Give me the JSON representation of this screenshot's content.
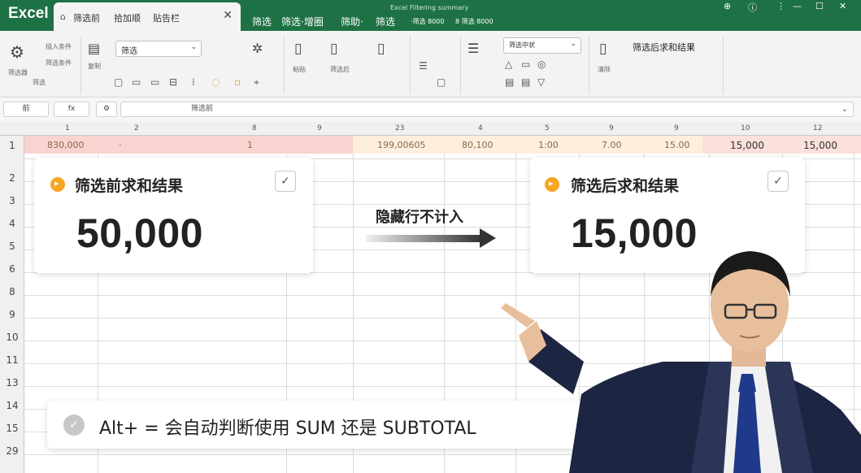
{
  "app": {
    "name": "Excel",
    "doc_title": "Excel Filtering summary"
  },
  "tab": {
    "items": [
      "筛选前",
      "拾加顺",
      "贴告栏"
    ]
  },
  "menu": [
    "筛选",
    "筛选·增圈",
    "筛助·",
    "筛选",
    "·筛选 8000",
    "8 筛选 8000"
  ],
  "ribbon": {
    "heading": "筛选后求和结果",
    "select1": "筛选",
    "select2": "筛选中状",
    "labels": [
      "筛选器",
      "插入条件",
      "筛选条件",
      "筛选",
      "复制",
      "粘贴",
      "筛选后",
      "清除"
    ]
  },
  "formula_bar": {
    "name_box": "前",
    "fx": "fx",
    "content": "筛选前"
  },
  "grid": {
    "columns": [
      "1",
      "2",
      "8",
      "9",
      "23",
      "4",
      "5",
      "9",
      "9",
      "10",
      "12"
    ],
    "rows": [
      "1",
      "2",
      "3",
      "4",
      "5",
      "6",
      "8",
      "9",
      "10",
      "11",
      "13",
      "14",
      "15",
      "29"
    ],
    "row1_values": [
      "830,000",
      "·",
      "1",
      "199,00605",
      "80,100",
      "1:00",
      "7.00",
      "15.00",
      "15,000",
      "15,000"
    ]
  },
  "card_before": {
    "title": "筛选前求和结果",
    "value": "50,000"
  },
  "card_after": {
    "title": "筛选后求和结果",
    "value": "15,000"
  },
  "arrow_label": "隐藏行不计入",
  "tip": {
    "text": "Alt+ = 会自动判断使用 SUM 还是 SUBTOTAL"
  },
  "colors": {
    "excel_green": "#1e7145",
    "accent_orange": "#f5a623",
    "row_pink": "#f9d3cf",
    "row_yellow": "#fdeedd"
  }
}
